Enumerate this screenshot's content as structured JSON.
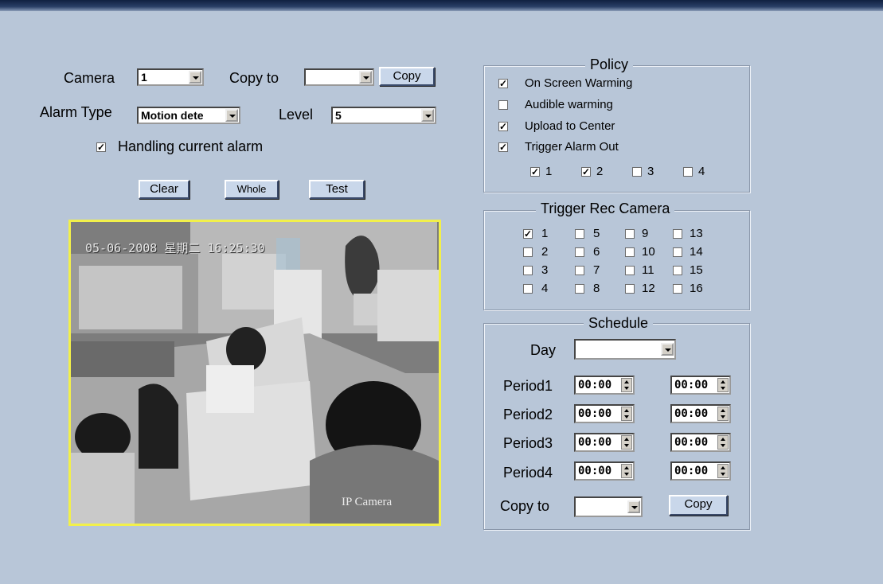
{
  "alarm": {
    "camera_label": "Camera",
    "camera_value": "1",
    "copy_to_label": "Copy to",
    "copy_to_value": "",
    "copy_button": "Copy",
    "alarm_type_label": "Alarm Type",
    "alarm_type_value": "Motion dete",
    "level_label": "Level",
    "level_value": "5",
    "handling_label": "Handling current alarm",
    "handling_checked": true,
    "clear_button": "Clear",
    "whole_button": "Whole",
    "test_button": "Test"
  },
  "video": {
    "osd_text": "05-06-2008 星期二 16:25:30",
    "watermark": "IP Camera"
  },
  "policy": {
    "title": "Policy",
    "options": [
      {
        "label": "On Screen Warming",
        "checked": true
      },
      {
        "label": "Audible warming",
        "checked": false
      },
      {
        "label": "Upload to Center",
        "checked": true
      },
      {
        "label": "Trigger Alarm Out",
        "checked": true
      }
    ],
    "outputs": [
      {
        "label": "1",
        "checked": true
      },
      {
        "label": "2",
        "checked": true
      },
      {
        "label": "3",
        "checked": false
      },
      {
        "label": "4",
        "checked": false
      }
    ]
  },
  "trigger_rec": {
    "title": "Trigger Rec Camera",
    "cameras": [
      {
        "label": "1",
        "checked": true
      },
      {
        "label": "2",
        "checked": false
      },
      {
        "label": "3",
        "checked": false
      },
      {
        "label": "4",
        "checked": false
      },
      {
        "label": "5",
        "checked": false
      },
      {
        "label": "6",
        "checked": false
      },
      {
        "label": "7",
        "checked": false
      },
      {
        "label": "8",
        "checked": false
      },
      {
        "label": "9",
        "checked": false
      },
      {
        "label": "10",
        "checked": false
      },
      {
        "label": "11",
        "checked": false
      },
      {
        "label": "12",
        "checked": false
      },
      {
        "label": "13",
        "checked": false
      },
      {
        "label": "14",
        "checked": false
      },
      {
        "label": "15",
        "checked": false
      },
      {
        "label": "16",
        "checked": false
      }
    ]
  },
  "schedule": {
    "title": "Schedule",
    "day_label": "Day",
    "day_value": "",
    "periods": [
      {
        "label": "Period1",
        "start": "00:00",
        "end": "00:00"
      },
      {
        "label": "Period2",
        "start": "00:00",
        "end": "00:00"
      },
      {
        "label": "Period3",
        "start": "00:00",
        "end": "00:00"
      },
      {
        "label": "Period4",
        "start": "00:00",
        "end": "00:00"
      }
    ],
    "copy_to_label": "Copy to",
    "copy_to_value": "",
    "copy_button": "Copy"
  }
}
